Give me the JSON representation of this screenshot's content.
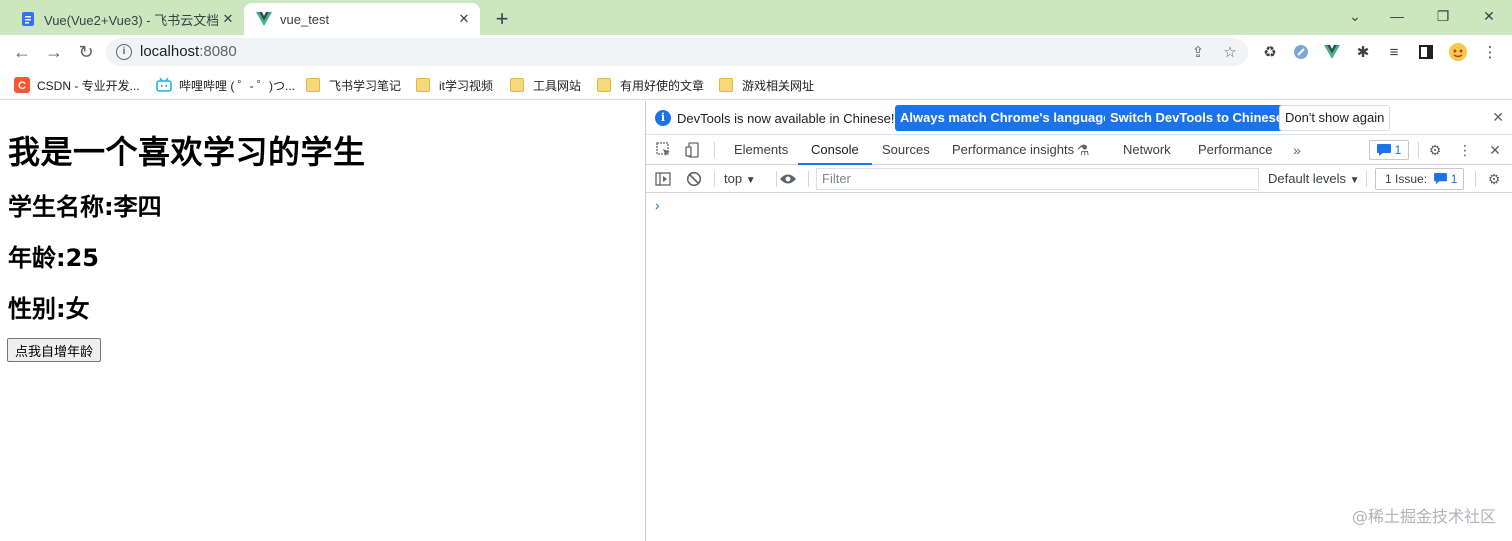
{
  "browser": {
    "tabs": [
      {
        "title": "Vue(Vue2+Vue3) - 飞书云文档",
        "icon": "feishu-doc-icon"
      },
      {
        "title": "vue_test",
        "icon": "vue-logo-icon"
      }
    ],
    "address": {
      "host": "localhost",
      "port": ":8080"
    },
    "bookmarks": [
      {
        "label": "CSDN - 专业开发...",
        "icon": "csdn-icon"
      },
      {
        "label": "哔哩哔哩 ( ゜- ゜)つ...",
        "icon": "bilibili-icon"
      },
      {
        "label": "飞书学习笔记",
        "icon": "folder-icon"
      },
      {
        "label": "it学习视频",
        "icon": "folder-icon"
      },
      {
        "label": "工具网站",
        "icon": "folder-icon"
      },
      {
        "label": "有用好使的文章",
        "icon": "folder-icon"
      },
      {
        "label": "游戏相关网址",
        "icon": "folder-icon"
      }
    ]
  },
  "page": {
    "heading": "我是一个喜欢学习的学生",
    "name_line": "学生名称:李四",
    "age_line": "年龄:25",
    "gender_line": "性别:女",
    "button_label": "点我自增年龄"
  },
  "devtools": {
    "infobar": {
      "message": "DevTools is now available in Chinese!",
      "btn_match": "Always match Chrome's language",
      "btn_switch": "Switch DevTools to Chinese",
      "btn_dismiss": "Don't show again"
    },
    "tabs": [
      "Elements",
      "Console",
      "Sources",
      "Performance insights",
      "Network",
      "Performance"
    ],
    "message_count": "1",
    "console": {
      "context": "top",
      "filter_placeholder": "Filter",
      "levels": "Default levels",
      "issues_label": "1 Issue:",
      "issues_count": "1",
      "prompt": "›"
    }
  },
  "watermark": "@稀土掘金技术社区",
  "colors": {
    "tabstrip": "#cce7c0",
    "accent": "#1a73e8"
  }
}
